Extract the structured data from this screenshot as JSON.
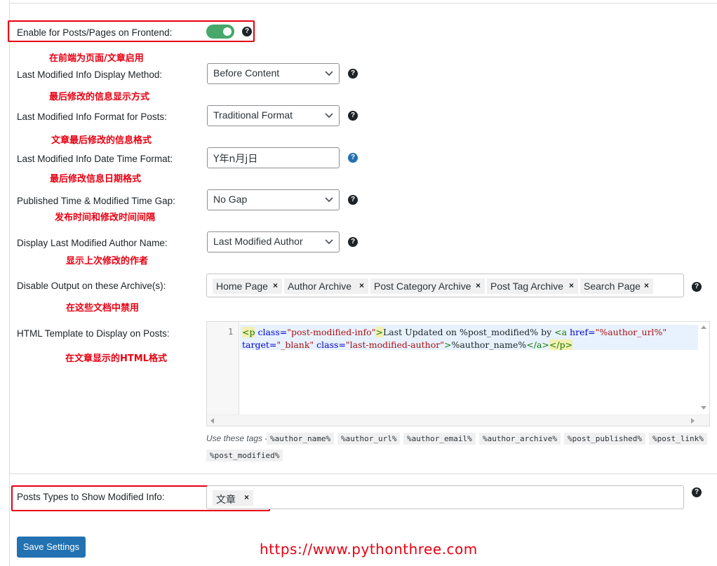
{
  "settings": {
    "enable_frontend": {
      "label": "Enable for Posts/Pages on Frontend:",
      "note": "在前端为页面/文章启用",
      "enabled": true
    },
    "display_method": {
      "label": "Last Modified Info Display Method:",
      "value": "Before Content",
      "note": "最后修改的信息显示方式"
    },
    "format_posts": {
      "label": "Last Modified Info Format for Posts:",
      "value": "Traditional Format",
      "note": "文章最后修改的信息格式"
    },
    "date_format": {
      "label": "Last Modified Info Date Time Format:",
      "value": "Y年n月j日",
      "note": "最后修改信息日期格式"
    },
    "time_gap": {
      "label": "Published Time & Modified Time Gap:",
      "value": "No Gap",
      "note": "发布时间和修改时间间隔"
    },
    "author_name": {
      "label": "Display Last Modified Author Name:",
      "value": "Last Modified Author",
      "note": "显示上次修改的作者"
    },
    "disable_archives": {
      "label": "Disable Output on these Archive(s):",
      "note": "在这些文档中禁用",
      "chips": [
        "Home Page",
        "Author Archive",
        "Post Category Archive",
        "Post Tag Archive",
        "Search Page"
      ]
    },
    "html_template": {
      "label": "HTML Template to Display on Posts:",
      "note": "在文章显示的HTML格式",
      "line_number": "1",
      "code_line1": {
        "p_open": "<p",
        "class_attr": " class=",
        "class_val": "\"post-modified-info\"",
        "p_close": ">",
        "text1": "Last Updated on %post_modified% by ",
        "a_open": "<a",
        "href_attr": " href=",
        "href_val": "\"%author_url%\""
      },
      "code_line2": {
        "target_attr": "target=",
        "target_val": "\"_blank\"",
        "class_attr": " class=",
        "class_val": "\"last-modified-author\"",
        "a_end": ">",
        "text2": "%author_name%",
        "a_close": "</a>",
        "p_end": "</p>"
      },
      "hint": "Use these tags -",
      "tags": [
        "%author_name%",
        "%author_url%",
        "%author_email%",
        "%author_archive%",
        "%post_published%",
        "%post_link%",
        "%post_modified%"
      ]
    },
    "post_types": {
      "label": "Posts Types to Show Modified Info:",
      "chips": [
        "文章"
      ]
    }
  },
  "help_icon": "?",
  "chip_remove": "×",
  "save_button": "Save Settings",
  "watermark": "https://www.pythonthree.com",
  "colors": {
    "accent": "#2271b1",
    "toggle_on": "#46a86b",
    "annotation": "#e60012"
  }
}
